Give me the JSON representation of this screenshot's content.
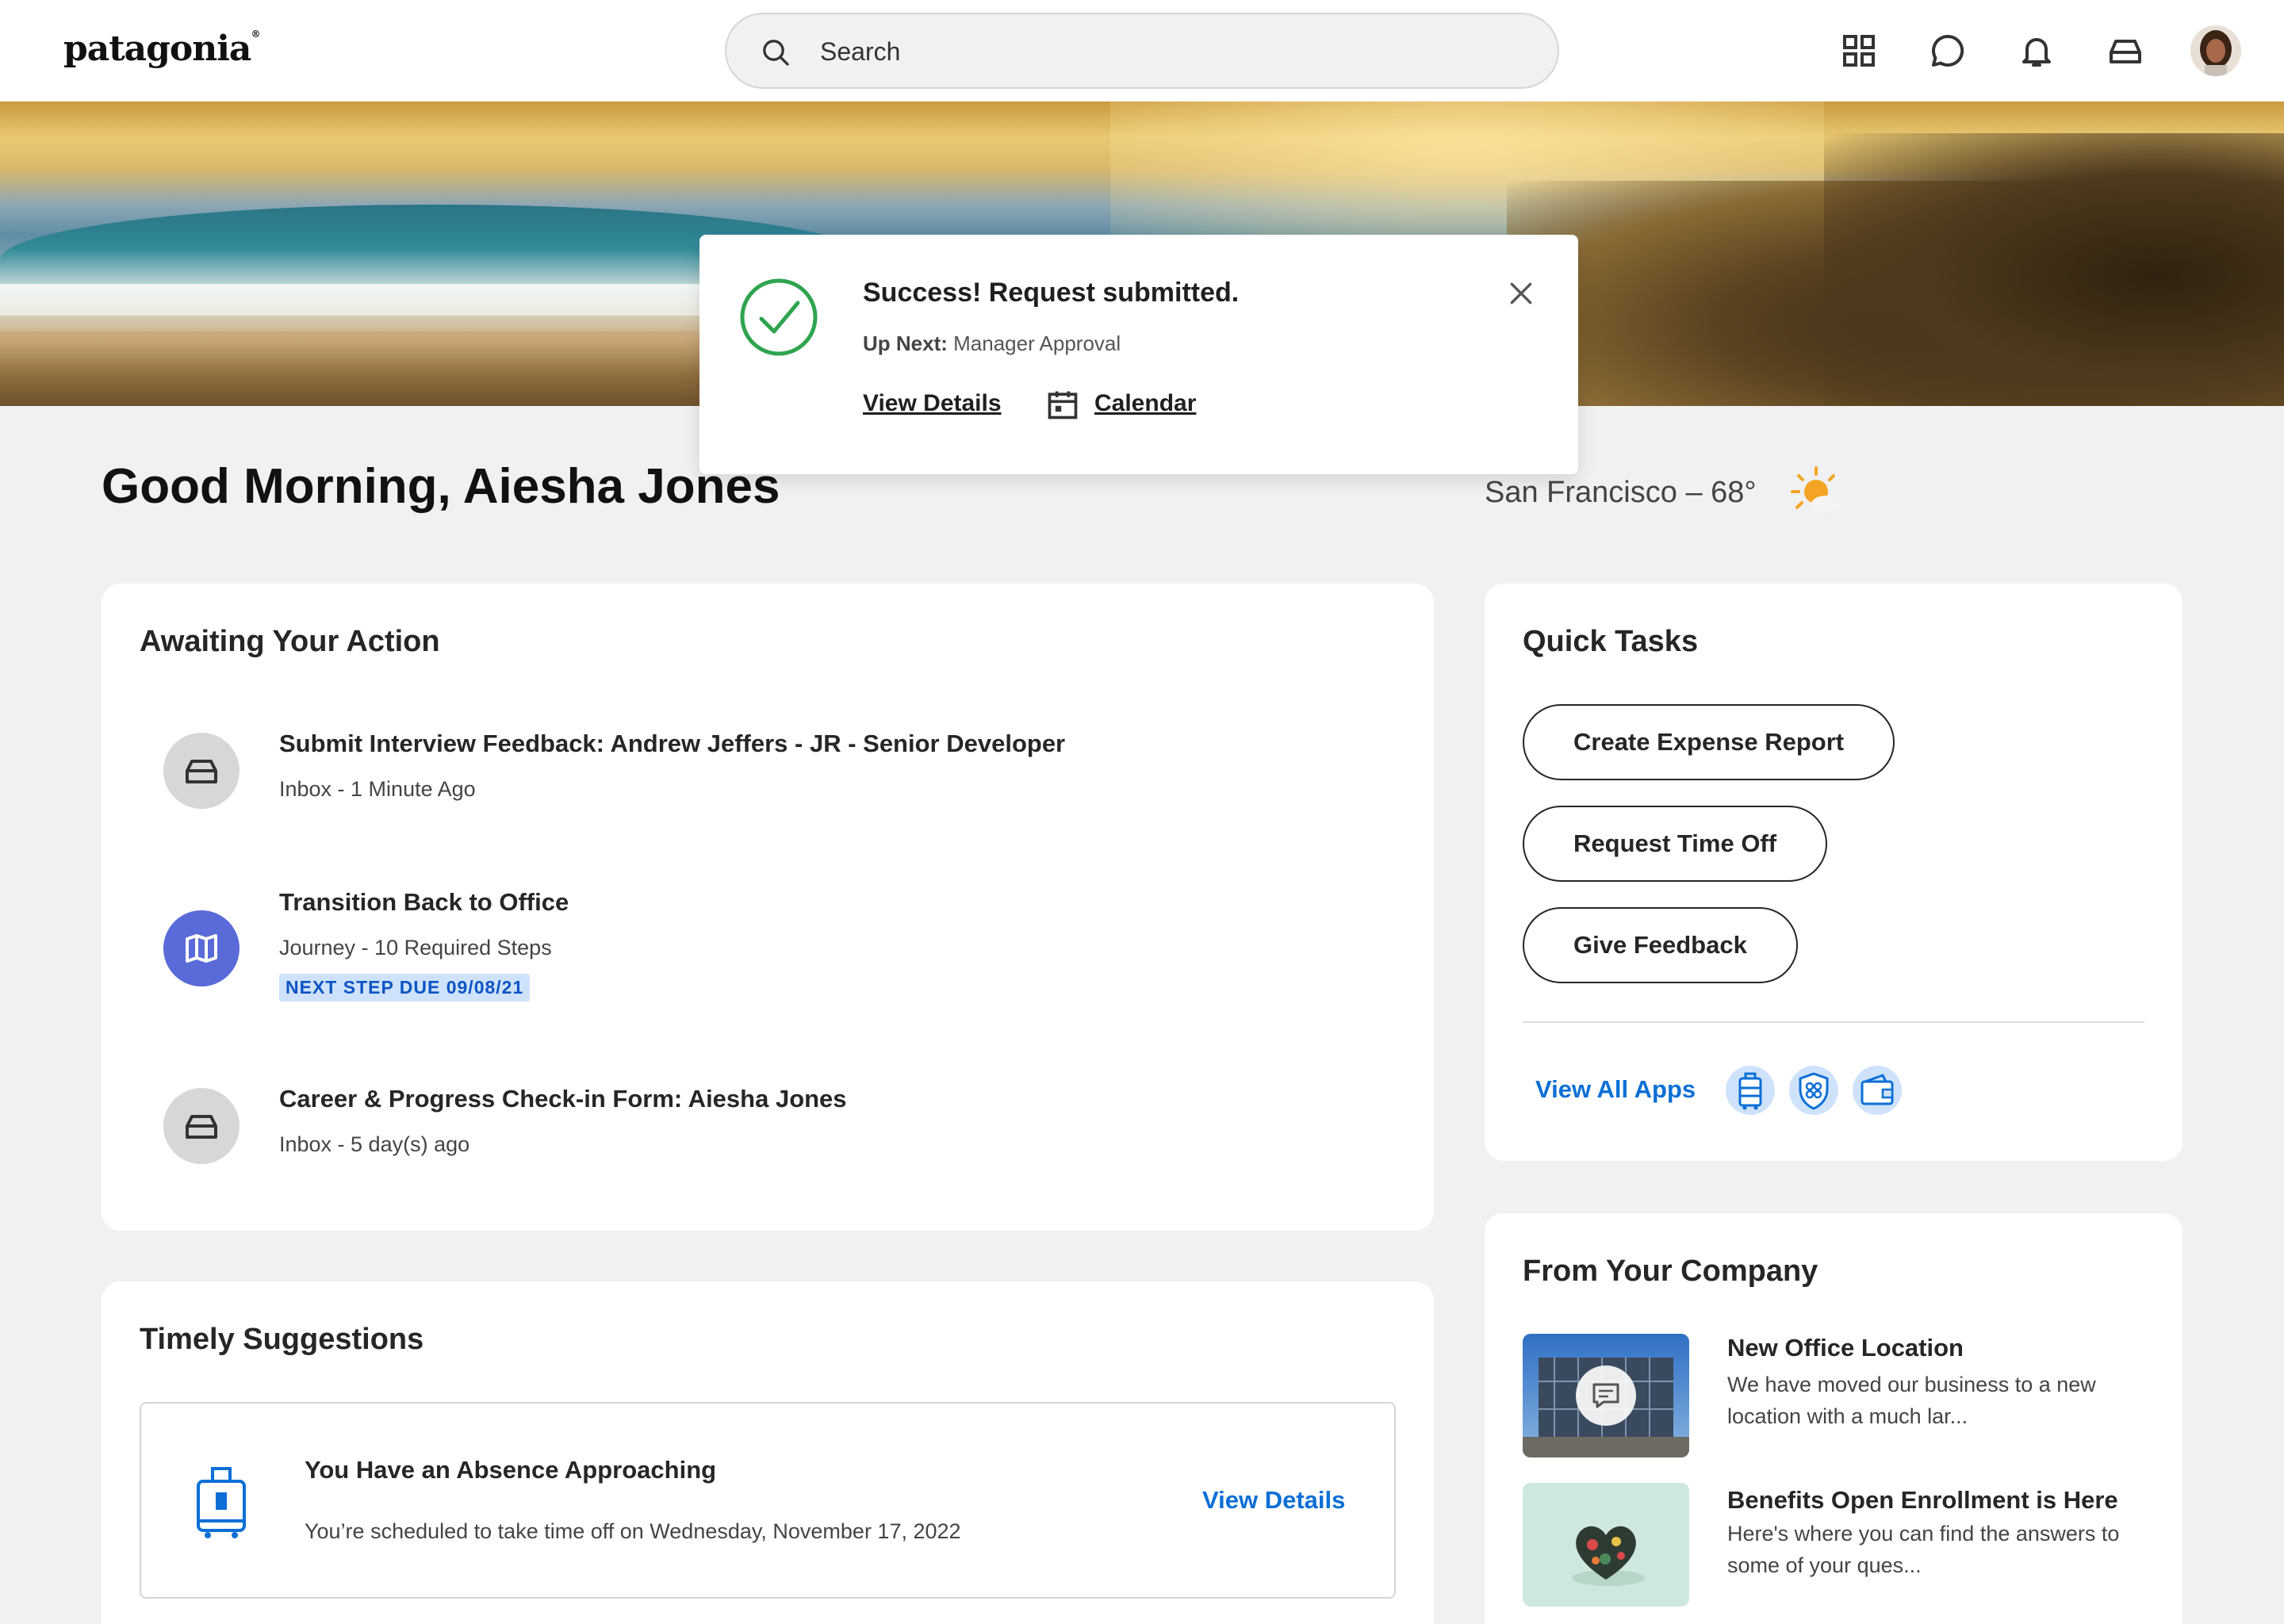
{
  "header": {
    "logo": "patagonia",
    "logo_mark": "®",
    "search_placeholder": "Search"
  },
  "toast": {
    "title": "Success! Request submitted.",
    "up_next_label": "Up Next:",
    "up_next_value": "Manager Approval",
    "view_details": "View Details",
    "calendar": "Calendar",
    "accent_color": "#2ea44f"
  },
  "greeting": "Good Morning, Aiesha Jones",
  "weather": {
    "text": "San Francisco – 68°",
    "icon": "partly-sunny-icon"
  },
  "awaiting": {
    "title": "Awaiting Your Action",
    "items": [
      {
        "title": "Submit Interview Feedback: Andrew Jeffers - JR - Senior Developer",
        "sub": "Inbox - 1 Minute Ago",
        "icon": "inbox-icon"
      },
      {
        "title": "Transition Back to Office",
        "sub": "Journey - 10 Required Steps",
        "badge": "NEXT STEP DUE 09/08/21",
        "icon": "map-icon"
      },
      {
        "title": "Career & Progress Check-in Form: Aiesha Jones",
        "sub": "Inbox - 5 day(s) ago",
        "icon": "inbox-icon"
      }
    ]
  },
  "quick_tasks": {
    "title": "Quick Tasks",
    "buttons": [
      "Create Expense Report",
      "Request Time Off",
      "Give Feedback"
    ],
    "view_all": "View All Apps",
    "app_icons": [
      "luggage-icon",
      "shield-icon",
      "wallet-icon"
    ]
  },
  "company": {
    "title": "From Your Company",
    "items": [
      {
        "title": "New Office Location",
        "desc": "We have moved our business to a new location with a much lar..."
      },
      {
        "title": "Benefits Open Enrollment is Here",
        "desc": "Here's where you can find the answers to some of your ques..."
      }
    ]
  },
  "suggestions": {
    "title": "Timely Suggestions",
    "card_title": "You Have an Absence Approaching",
    "card_sub": "You’re scheduled to take time off on Wednesday, November 17, 2022",
    "link": "View Details"
  },
  "colors": {
    "link_blue": "#0b6fd6",
    "journey_purple": "#5b6ad9",
    "badge_bg": "#cfe2fb"
  }
}
